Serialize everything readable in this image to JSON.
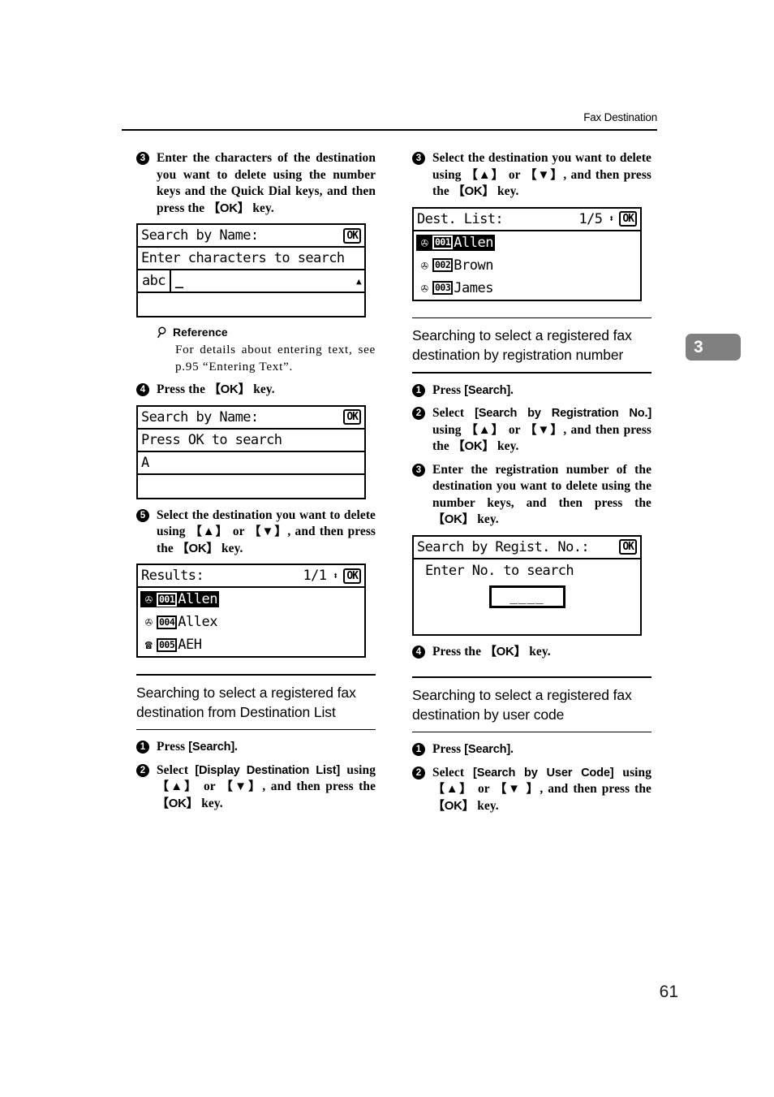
{
  "header": {
    "running_head": "Fax Destination"
  },
  "chapter_tab": {
    "number": "3"
  },
  "footer": {
    "page_number": "61"
  },
  "left_column": {
    "step3": {
      "bullet": "3",
      "text_parts": [
        "Enter the characters of the destination you want to delete using the number keys and the Quick Dial keys, and then press the ",
        "【OK】",
        " key."
      ]
    },
    "lcd_search_by_name_1": {
      "title": "Search by Name:",
      "ok_label": "OK",
      "prompt": "Enter characters to search",
      "mode": "abc",
      "entry_value": "_",
      "scroll_arrow": "▲"
    },
    "reference": {
      "icon": "magnifier-icon",
      "title": "Reference",
      "body": "For details about entering text, see p.95 “Entering Text”."
    },
    "step4": {
      "bullet": "4",
      "text_parts": [
        "Press the ",
        "【OK】",
        " key."
      ]
    },
    "lcd_search_by_name_2": {
      "title": "Search by Name:",
      "ok_label": "OK",
      "prompt": "Press OK to search",
      "entry_value": "A"
    },
    "step5": {
      "bullet": "5",
      "text_parts": [
        "Select the destination you want to delete using ",
        "【▲】",
        " or ",
        "【▼】",
        ", and then press the ",
        "【OK】",
        " key."
      ]
    },
    "lcd_results": {
      "title": "Results:",
      "page_indicator": "1/1",
      "updown": "⬍",
      "ok_label": "OK",
      "items": [
        {
          "icon": "fax-icon",
          "number": "001",
          "name": "Allen",
          "selected": true
        },
        {
          "icon": "fax-icon",
          "number": "004",
          "name": "Allex",
          "selected": false
        },
        {
          "icon": "phone-icon",
          "number": "005",
          "name": "AEH",
          "selected": false
        }
      ]
    },
    "section_dest_list": {
      "heading": "Searching to select a registered fax destination from Destination List",
      "steps": [
        {
          "bullet": "1",
          "text_parts": [
            "Press ",
            "[Search]",
            "."
          ]
        },
        {
          "bullet": "2",
          "text_parts": [
            "Select ",
            "[Display Destination List]",
            " using ",
            "【▲】",
            " or ",
            "【▼】",
            ", and then press the ",
            "【OK】",
            " key."
          ]
        }
      ]
    }
  },
  "right_column": {
    "step3": {
      "bullet": "3",
      "text_parts": [
        "Select the destination you want to delete using ",
        "【▲】",
        " or ",
        "【▼】",
        ", and then press the ",
        "【OK】",
        " key."
      ]
    },
    "lcd_dest_list": {
      "title": "Dest. List:",
      "page_indicator": "1/5",
      "updown": "⬍",
      "ok_label": "OK",
      "items": [
        {
          "icon": "fax-icon",
          "number": "001",
          "name": "Allen",
          "selected": true
        },
        {
          "icon": "fax-icon",
          "number": "002",
          "name": "Brown",
          "selected": false
        },
        {
          "icon": "fax-icon",
          "number": "003",
          "name": "James",
          "selected": false
        }
      ]
    },
    "section_regist_no": {
      "heading": "Searching to select a registered fax destination by registration number",
      "steps": [
        {
          "bullet": "1",
          "text_parts": [
            "Press ",
            "[Search]",
            "."
          ]
        },
        {
          "bullet": "2",
          "text_parts": [
            "Select ",
            "[Search by Registration No.]",
            " using ",
            "【▲】",
            " or ",
            "【▼】",
            ", and then press the ",
            "【OK】",
            " key."
          ]
        },
        {
          "bullet": "3",
          "text_parts": [
            "Enter the registration number of the destination you want to delete using the number keys, and then press the ",
            "【OK】",
            " key."
          ]
        }
      ]
    },
    "lcd_regist_no": {
      "title": "Search by Regist. No.:",
      "ok_label": "OK",
      "prompt": "Enter No. to search",
      "entry_value": "____"
    },
    "step4": {
      "bullet": "4",
      "text_parts": [
        "Press the ",
        "【OK】",
        " key."
      ]
    },
    "section_user_code": {
      "heading": "Searching to select a registered fax destination by user code",
      "steps": [
        {
          "bullet": "1",
          "text_parts": [
            "Press ",
            "[Search]",
            "."
          ]
        },
        {
          "bullet": "2",
          "text_parts": [
            "Select ",
            "[Search by User Code]",
            " using ",
            "【▲】",
            " or ",
            "【▼ 】",
            ", and then press the ",
            "【OK】",
            " key."
          ]
        }
      ]
    }
  }
}
